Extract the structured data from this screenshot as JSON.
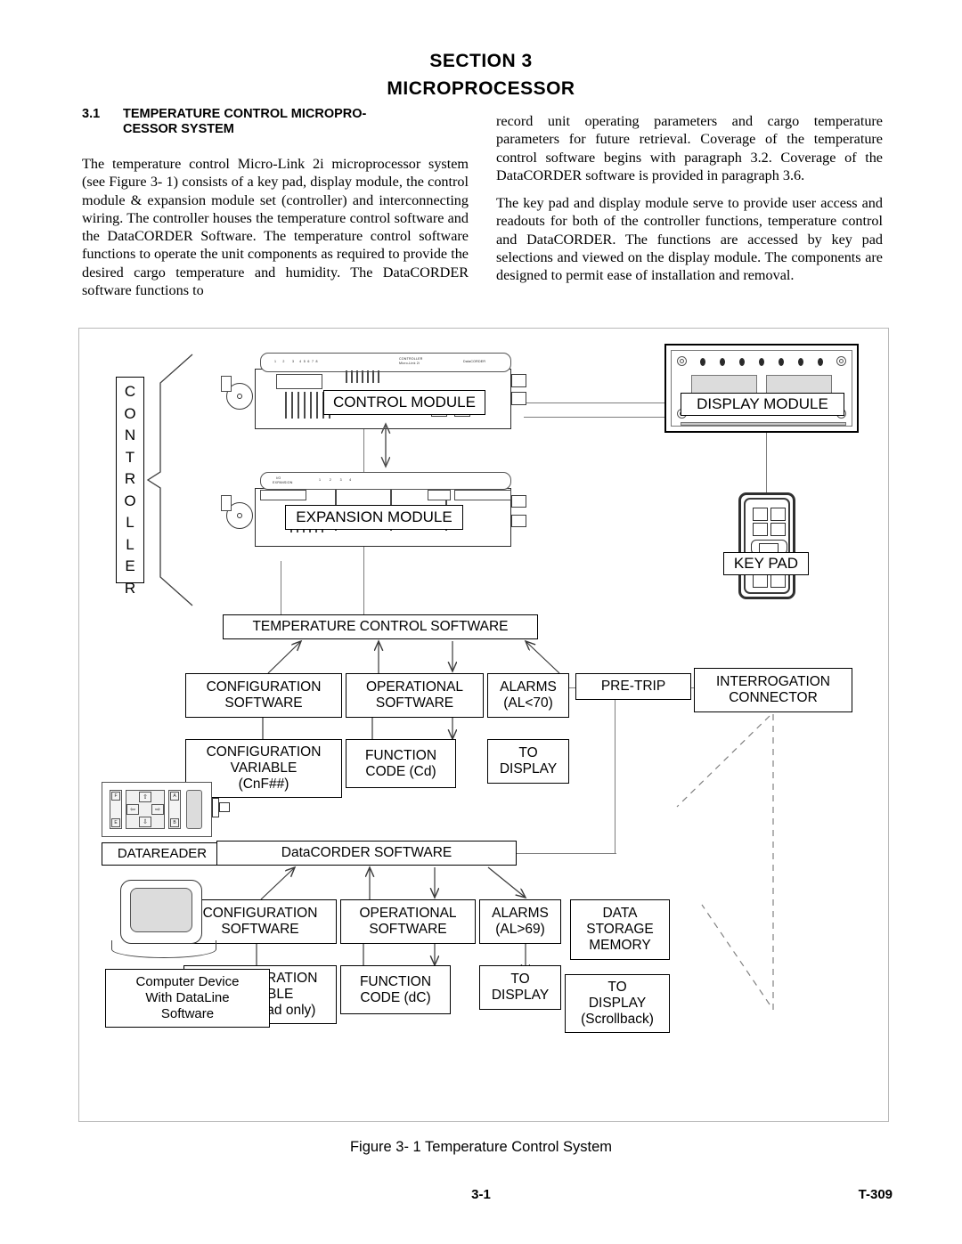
{
  "header": {
    "section_line": "SECTION  3",
    "section_title": "MICROPROCESSOR",
    "subsection_number": "3.1",
    "subsection_title": "TEMPERATURE CONTROL MICROPRO-",
    "subsection_title_cont": "CESSOR SYSTEM"
  },
  "body": {
    "left_paragraph_1": "The temperature control Micro-Link 2i microprocessor system (see Figure 3- 1) consists of a key pad, display module, the control module & expansion module set (controller) and interconnecting wiring. The controller houses the temperature control software and the DataCORDER Software. The temperature control software functions to operate the unit components as required to provide the desired cargo temperature and humidity. The DataCORDER software functions to",
    "right_paragraph_1": "record unit operating parameters and cargo temperature parameters for future retrieval. Coverage of the temperature control software begins with paragraph 3.2. Coverage of the DataCORDER software is provided in paragraph 3.6.",
    "right_paragraph_2": "The key pad and display module serve to provide user access and readouts for both of the controller functions, temperature control and DataCORDER. The functions are accessed by key pad selections and viewed on the display module. The components are designed to permit ease of installation and removal."
  },
  "figure": {
    "caption": "Figure 3- 1 Temperature Control System",
    "controller_bracket_label": "CONTROLLER",
    "control_module_label": "CONTROL MODULE",
    "expansion_module_label": "EXPANSION MODULE",
    "control_module_faceplate_line1": "CONTROLLER",
    "control_module_faceplate_line2": "Micro-Link 2i",
    "control_module_faceplate_right": "DataCORDER",
    "expansion_module_faceplate_line1": "I/O",
    "expansion_module_faceplate_line2": "EXPANSION",
    "display_module_label": "DISPLAY MODULE",
    "keypad_label": "KEY PAD",
    "temperature_control_software": "TEMPERATURE CONTROL SOFTWARE",
    "datacorder_software": "DataCORDER SOFTWARE",
    "interrogation_connector_line1": "INTERROGATION",
    "interrogation_connector_line2": "CONNECTOR",
    "datareader_label": "DATAREADER",
    "computer_line1": "Computer Device",
    "computer_line2": "With DataLine",
    "computer_line3": "Software",
    "tc_branches": [
      {
        "line1": "CONFIGURATION",
        "line2": "SOFTWARE",
        "child_line1": "CONFIGURATION",
        "child_line2": "VARIABLE",
        "child_line3": "(CnF##)"
      },
      {
        "line1": "OPERATIONAL",
        "line2": "SOFTWARE",
        "child_line1": "FUNCTION",
        "child_line2": "CODE (Cd)",
        "child_line3": ""
      },
      {
        "line1": "ALARMS",
        "line2": "(AL<70)",
        "child_line1": "TO",
        "child_line2": "DISPLAY",
        "child_line3": ""
      },
      {
        "line1": "PRE-TRIP",
        "line2": "",
        "child_line1": "",
        "child_line2": "",
        "child_line3": ""
      }
    ],
    "dc_branches": [
      {
        "line1": "CONFIGURATION",
        "line2": "SOFTWARE",
        "line3": "",
        "child_line1": "CONFIGURATION",
        "child_line2": "VARIABLE",
        "child_line3": "(dCF## read only)"
      },
      {
        "line1": "OPERATIONAL",
        "line2": "SOFTWARE",
        "line3": "",
        "child_line1": "FUNCTION",
        "child_line2": "CODE (dC)",
        "child_line3": ""
      },
      {
        "line1": "ALARMS",
        "line2": "(AL>69)",
        "line3": "",
        "child_line1": "TO",
        "child_line2": "DISPLAY",
        "child_line3": ""
      },
      {
        "line1": "DATA",
        "line2": "STORAGE",
        "line3": "MEMORY",
        "child_line1": "TO",
        "child_line2": "DISPLAY",
        "child_line3": "(Scrollback)"
      }
    ],
    "datareader_keys": {
      "up": "⇧",
      "down": "⇩",
      "left": "⇦",
      "right": "⇨"
    }
  },
  "footer": {
    "page_number": "3-1",
    "document_number": "T-309"
  }
}
